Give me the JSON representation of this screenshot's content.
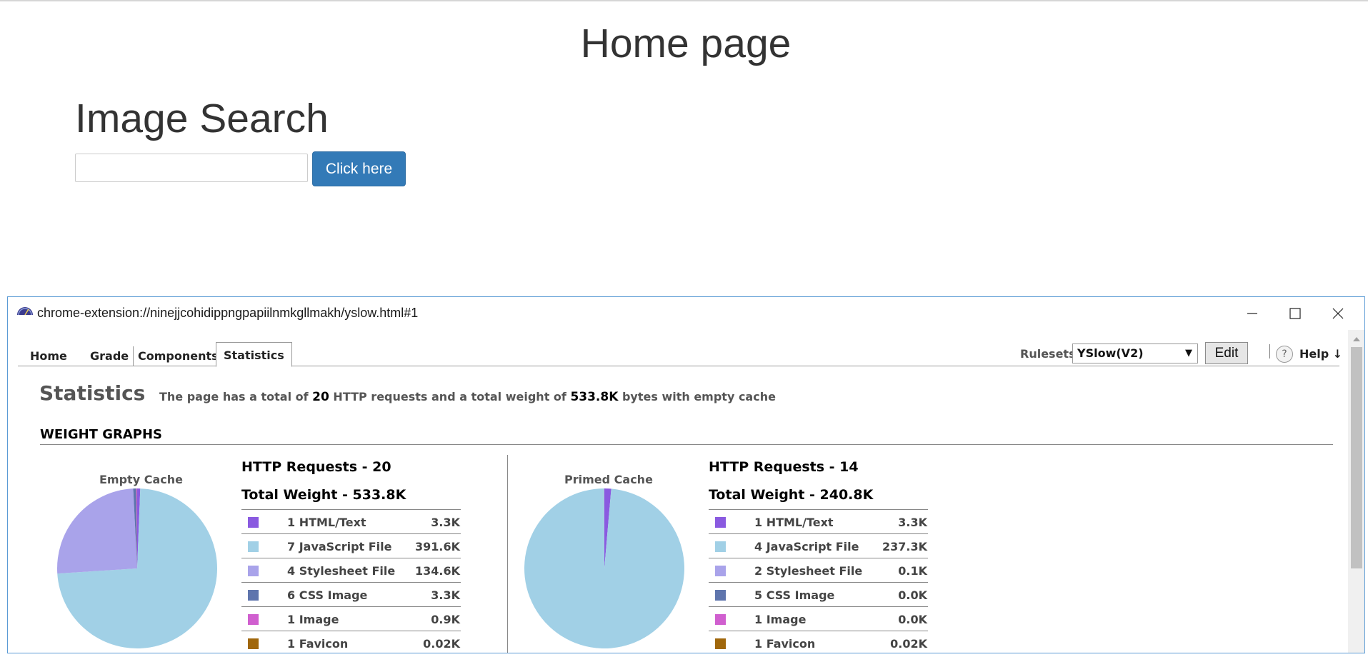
{
  "page": {
    "title": "Home page",
    "search_heading": "Image Search",
    "search_input_value": "",
    "search_button": "Click here"
  },
  "window": {
    "title": "chrome-extension://ninejjcohidippngpapiilnmkgllmakh/yslow.html#1",
    "icon": "yslow-speedometer-icon"
  },
  "tabs": [
    {
      "label": "Home",
      "active": false
    },
    {
      "label": "Grade",
      "active": false
    },
    {
      "label": "Components",
      "active": false
    },
    {
      "label": "Statistics",
      "active": true
    }
  ],
  "toolbar": {
    "rulesets_label": "Rulesets",
    "ruleset_selected": "YSlow(V2)",
    "edit_label": "Edit",
    "help_icon": "?",
    "help_label": "Help ↓"
  },
  "stats": {
    "heading": "Statistics",
    "summary_a": "The page has a total of",
    "summary_requests": "20",
    "summary_b": "HTTP requests and a total weight of",
    "summary_weight": "533.8K",
    "summary_c": "bytes with empty cache",
    "weight_graphs_heading": "WEIGHT GRAPHS"
  },
  "empty_cache": {
    "label": "Empty Cache",
    "requests_title": "HTTP Requests - 20",
    "weight_title": "Total Weight - 533.8K",
    "rows": [
      {
        "label": "1 HTML/Text",
        "value": "3.3K",
        "kb": 3.3,
        "color": "#8a5ae0"
      },
      {
        "label": "7 JavaScript File",
        "value": "391.6K",
        "kb": 391.6,
        "color": "#a1d0e6"
      },
      {
        "label": "4 Stylesheet File",
        "value": "134.6K",
        "kb": 134.6,
        "color": "#a9a3ea"
      },
      {
        "label": "6 CSS Image",
        "value": "3.3K",
        "kb": 3.3,
        "color": "#5f75ad"
      },
      {
        "label": "1 Image",
        "value": "0.9K",
        "kb": 0.9,
        "color": "#d05fcf"
      },
      {
        "label": "1 Favicon",
        "value": "0.02K",
        "kb": 0.02,
        "color": "#a0670c"
      }
    ]
  },
  "primed_cache": {
    "label": "Primed Cache",
    "requests_title": "HTTP Requests - 14",
    "weight_title": "Total Weight - 240.8K",
    "rows": [
      {
        "label": "1 HTML/Text",
        "value": "3.3K",
        "kb": 3.3,
        "color": "#8a5ae0"
      },
      {
        "label": "4 JavaScript File",
        "value": "237.3K",
        "kb": 237.3,
        "color": "#a1d0e6"
      },
      {
        "label": "2 Stylesheet File",
        "value": "0.1K",
        "kb": 0.1,
        "color": "#a9a3ea"
      },
      {
        "label": "5 CSS Image",
        "value": "0.0K",
        "kb": 0.0,
        "color": "#5f75ad"
      },
      {
        "label": "1 Image",
        "value": "0.0K",
        "kb": 0.0,
        "color": "#d05fcf"
      },
      {
        "label": "1 Favicon",
        "value": "0.02K",
        "kb": 0.02,
        "color": "#a0670c"
      }
    ]
  }
}
